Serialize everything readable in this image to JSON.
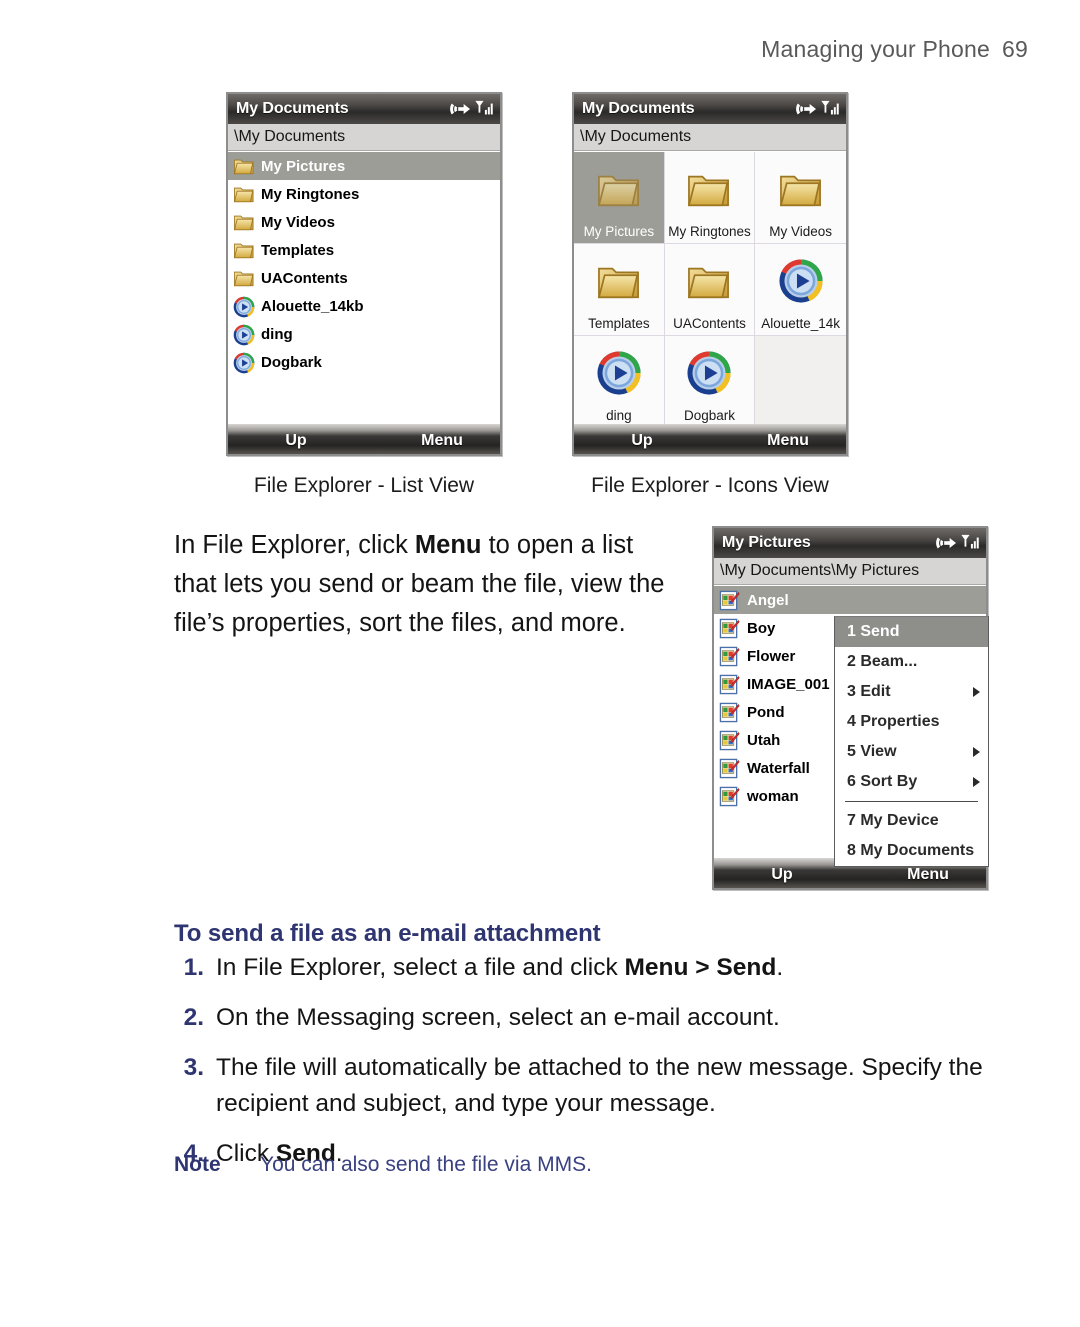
{
  "page": {
    "header_title": "Managing your Phone",
    "page_number": "69"
  },
  "screens": {
    "list_view": {
      "title": "My Documents",
      "address": "\\My Documents",
      "softkey_left": "Up",
      "softkey_right": "Menu",
      "caption": "File Explorer - List View",
      "items": [
        {
          "label": "My Pictures",
          "icon": "folder-icon",
          "selected": true
        },
        {
          "label": "My Ringtones",
          "icon": "folder-icon",
          "selected": false
        },
        {
          "label": "My Videos",
          "icon": "folder-icon",
          "selected": false
        },
        {
          "label": "Templates",
          "icon": "folder-icon",
          "selected": false
        },
        {
          "label": "UAContents",
          "icon": "folder-icon",
          "selected": false
        },
        {
          "label": "Alouette_14kb",
          "icon": "media-file-icon",
          "selected": false
        },
        {
          "label": "ding",
          "icon": "media-file-icon",
          "selected": false
        },
        {
          "label": "Dogbark",
          "icon": "media-file-icon",
          "selected": false
        }
      ]
    },
    "icons_view": {
      "title": "My Documents",
      "address": "\\My Documents",
      "softkey_left": "Up",
      "softkey_right": "Menu",
      "caption": "File Explorer - Icons View",
      "items": [
        {
          "label": "My Pictures",
          "icon": "folder-icon",
          "selected": true
        },
        {
          "label": "My Ringtones",
          "icon": "folder-icon",
          "selected": false
        },
        {
          "label": "My Videos",
          "icon": "folder-icon",
          "selected": false
        },
        {
          "label": "Templates",
          "icon": "folder-icon",
          "selected": false
        },
        {
          "label": "UAContents",
          "icon": "folder-icon",
          "selected": false
        },
        {
          "label": "Alouette_14k",
          "icon": "media-file-icon",
          "selected": false
        },
        {
          "label": "ding",
          "icon": "media-file-icon",
          "selected": false
        },
        {
          "label": "Dogbark",
          "icon": "media-file-icon",
          "selected": false
        }
      ]
    },
    "my_pictures": {
      "title": "My Pictures",
      "address": "\\My Documents\\My Pictures",
      "softkey_left": "Up",
      "softkey_right": "Menu",
      "items": [
        {
          "label": "Angel",
          "icon": "image-file-icon",
          "selected": true
        },
        {
          "label": "Boy",
          "icon": "image-file-icon",
          "selected": false
        },
        {
          "label": "Flower",
          "icon": "image-file-icon",
          "selected": false
        },
        {
          "label": "IMAGE_001",
          "icon": "image-file-icon",
          "selected": false
        },
        {
          "label": "Pond",
          "icon": "image-file-icon",
          "selected": false
        },
        {
          "label": "Utah",
          "icon": "image-file-icon",
          "selected": false
        },
        {
          "label": "Waterfall",
          "icon": "image-file-icon",
          "selected": false
        },
        {
          "label": "woman",
          "icon": "image-file-icon",
          "selected": false
        }
      ],
      "context_menu": [
        {
          "label": "1 Send",
          "submenu": false,
          "selected": true,
          "separator_after": false
        },
        {
          "label": "2 Beam...",
          "submenu": false,
          "selected": false,
          "separator_after": false
        },
        {
          "label": "3 Edit",
          "submenu": true,
          "selected": false,
          "separator_after": false
        },
        {
          "label": "4 Properties",
          "submenu": false,
          "selected": false,
          "separator_after": false
        },
        {
          "label": "5 View",
          "submenu": true,
          "selected": false,
          "separator_after": false
        },
        {
          "label": "6 Sort By",
          "submenu": true,
          "selected": false,
          "separator_after": true
        },
        {
          "label": "7 My Device",
          "submenu": false,
          "selected": false,
          "separator_after": false
        },
        {
          "label": "8 My Documents",
          "submenu": false,
          "selected": false,
          "separator_after": false
        }
      ]
    }
  },
  "body": {
    "intro_paragraph": {
      "part1": "In File Explorer, click ",
      "bold1": "Menu",
      "part2": " to open a list that lets you send or beam the file, view the file’s properties, sort the files, and more."
    },
    "section_heading": "To send a file as an e-mail attachment",
    "steps": [
      {
        "num": "1.",
        "pre": "In File Explorer, select a file and click ",
        "bold": "Menu > Send",
        "post": "."
      },
      {
        "num": "2.",
        "pre": "On the Messaging screen, select an e-mail account.",
        "bold": "",
        "post": ""
      },
      {
        "num": "3.",
        "pre": "The file will automatically be attached to the new message. Specify the recipient and subject, and type your message.",
        "bold": "",
        "post": ""
      },
      {
        "num": "4.",
        "pre": "Click ",
        "bold": "Send",
        "post": "."
      }
    ],
    "note": {
      "label": "Note",
      "text": "You can also send the file via MMS."
    }
  },
  "colors": {
    "heading_indigo": "#2e3571",
    "selection_gray": "#9d9d98",
    "titlebar_dark": "#2c2a29"
  }
}
